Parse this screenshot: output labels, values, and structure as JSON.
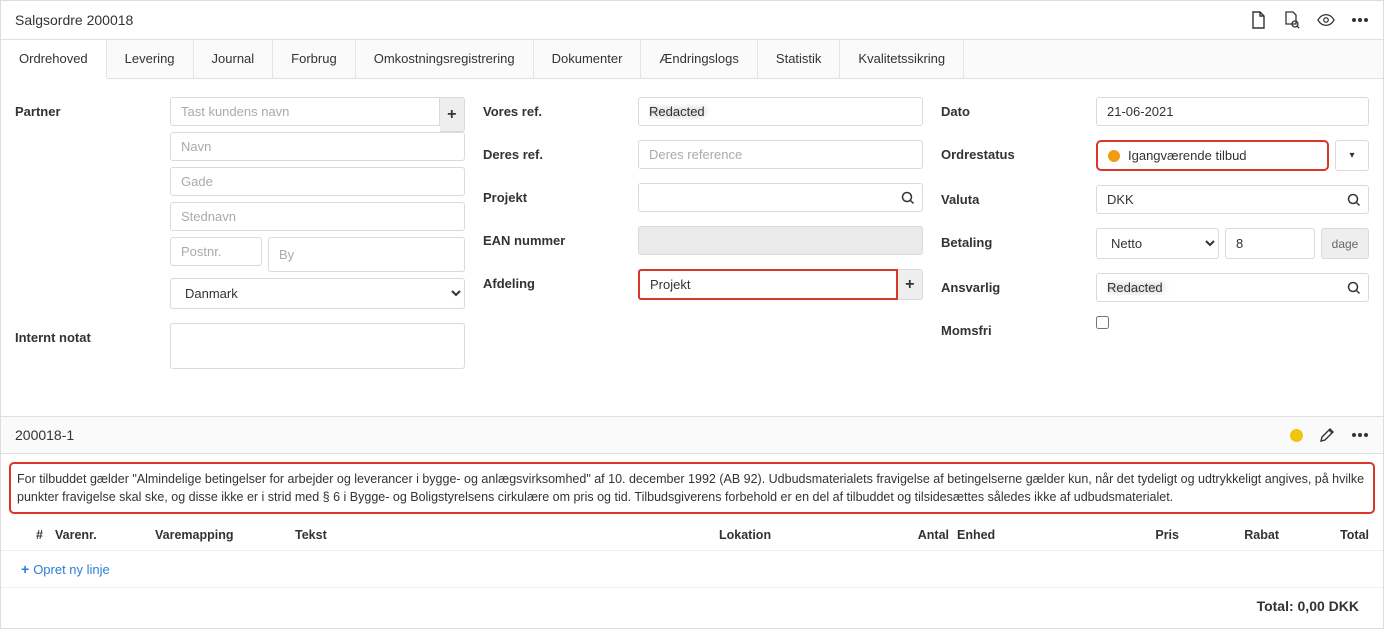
{
  "header": {
    "title": "Salgsordre 200018"
  },
  "tabs": [
    "Ordrehoved",
    "Levering",
    "Journal",
    "Forbrug",
    "Omkostningsregistrering",
    "Dokumenter",
    "Ændringslogs",
    "Statistik",
    "Kvalitetssikring"
  ],
  "col1": {
    "partner_label": "Partner",
    "partner_ph": "Tast kundens navn",
    "navn_ph": "Navn",
    "gade_ph": "Gade",
    "stednavn_ph": "Stednavn",
    "postnr_ph": "Postnr.",
    "by_ph": "By",
    "country": "Danmark",
    "internt_label": "Internt notat"
  },
  "col2": {
    "vores_ref_label": "Vores ref.",
    "vores_ref_val": "Redacted",
    "deres_ref_label": "Deres ref.",
    "deres_ref_ph": "Deres reference",
    "projekt_label": "Projekt",
    "ean_label": "EAN nummer",
    "afdeling_label": "Afdeling",
    "afdeling_val": "Projekt"
  },
  "col3": {
    "dato_label": "Dato",
    "dato_val": "21-06-2021",
    "ordrestatus_label": "Ordrestatus",
    "ordrestatus_val": "Igangværende tilbud",
    "valuta_label": "Valuta",
    "valuta_val": "DKK",
    "betaling_label": "Betaling",
    "betaling_val": "Netto",
    "betaling_days": "8",
    "betaling_unit": "dage",
    "ansvarlig_label": "Ansvarlig",
    "ansvarlig_val": "Redacted",
    "momsfri_label": "Momsfri"
  },
  "lines": {
    "title": "200018-1",
    "note": "For tilbuddet gælder \"Almindelige betingelser for arbejder og leverancer i bygge- og anlægsvirksomhed\" af 10. december 1992 (AB 92). Udbudsmaterialets fravigelse af betingelserne gælder kun, når det tydeligt og udtrykkeligt angives, på hvilke punkter fravigelse skal ske, og disse ikke er i strid med § 6 i Bygge- og Boligstyrelsens cirkulære om pris og tid. Tilbudsgiverens forbehold er en del af tilbuddet og tilsidesættes således ikke af udbudsmaterialet.",
    "cols": {
      "hash": "#",
      "varenr": "Varenr.",
      "map": "Varemapping",
      "tekst": "Tekst",
      "lok": "Lokation",
      "antal": "Antal",
      "enhed": "Enhed",
      "pris": "Pris",
      "rabat": "Rabat",
      "total": "Total"
    },
    "new_line": "Opret ny linje",
    "total_label": "Total: 0,00 DKK"
  }
}
